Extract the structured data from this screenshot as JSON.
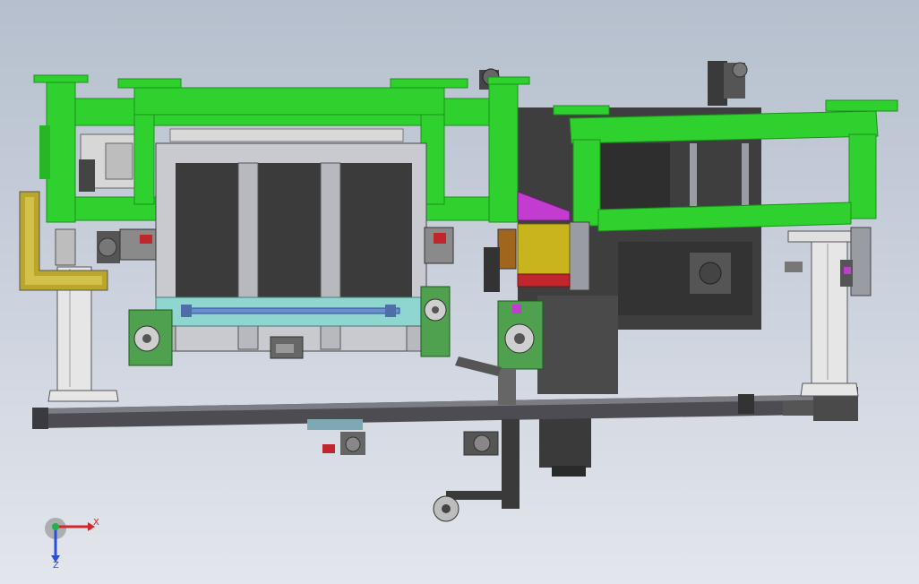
{
  "viewport": {
    "background_top": "#b6bfcd",
    "background_bottom": "#e3e6ec"
  },
  "model": {
    "colors": {
      "frame_green": "#2fd12f",
      "frame_green_dark": "#1c8f1c",
      "steel_dark": "#3a3a3a",
      "steel_mid": "#5b5b5b",
      "steel_light": "#9a9ca3",
      "plate_grey": "#c9cacf",
      "glass_cyan": "#8fd6d0",
      "yellow_part": "#c8b41c",
      "olive_bracket": "#b9a62a",
      "magenta_part": "#c23ccf",
      "red_part": "#c0272d",
      "blue_rod": "#6a8fd0",
      "column_white": "#e6e6e6"
    }
  },
  "triad": {
    "x_label": "X",
    "z_label": "Z",
    "x_color": "#d1262b",
    "z_color": "#2a4fd6",
    "y_color": "#22b14c"
  }
}
